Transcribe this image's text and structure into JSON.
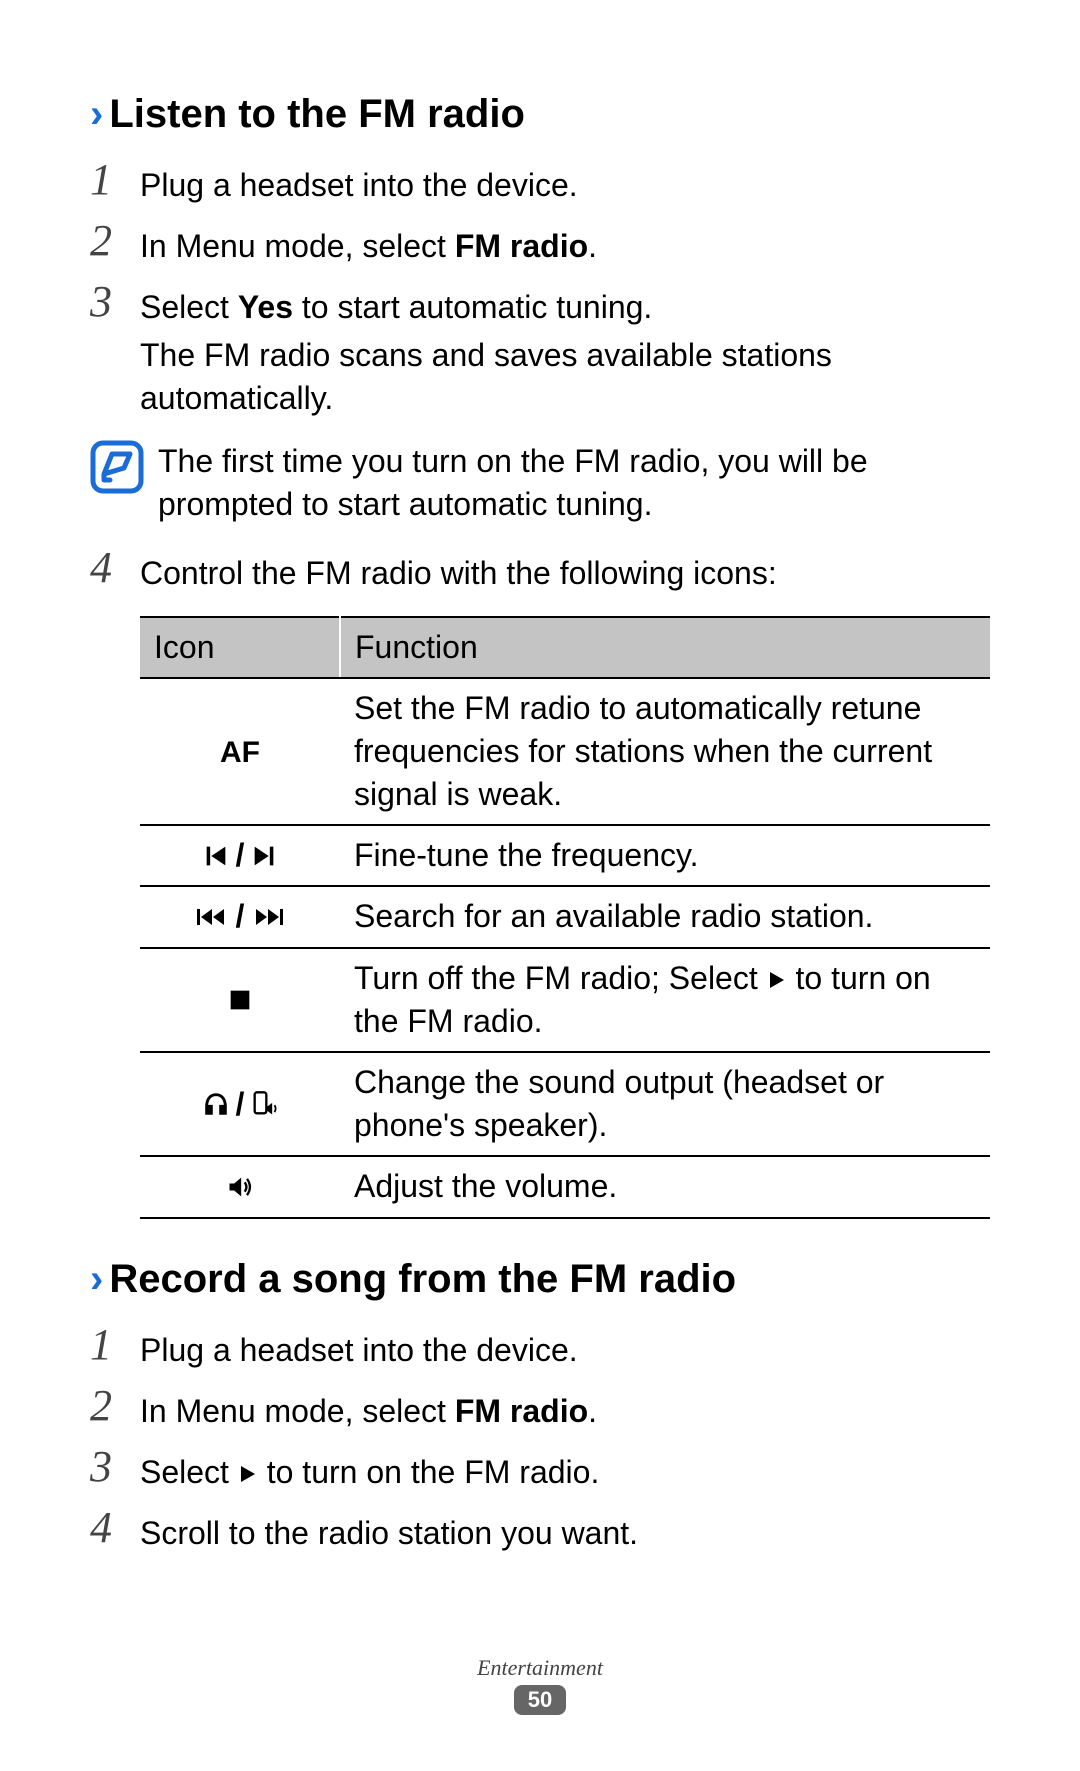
{
  "section1": {
    "title": "Listen to the FM radio",
    "steps": [
      {
        "num": "1",
        "text": "Plug a headset into the device."
      },
      {
        "num": "2",
        "prefix": "In Menu mode, select ",
        "bold": "FM radio",
        "suffix": "."
      },
      {
        "num": "3",
        "prefix": "Select ",
        "bold": "Yes",
        "suffix": " to start automatic tuning.",
        "subtext": "The FM radio scans and saves available stations automatically."
      },
      {
        "num": "4",
        "text": "Control the FM radio with the following icons:"
      }
    ],
    "note": "The first time you turn on the FM radio, you will be prompted to start automatic tuning."
  },
  "table": {
    "headers": [
      "Icon",
      "Function"
    ],
    "rows": [
      {
        "icon_label": "AF",
        "function": "Set the FM radio to automatically retune frequencies for stations when the current signal is weak."
      },
      {
        "function": "Fine-tune the frequency."
      },
      {
        "function": "Search for an available radio station."
      },
      {
        "function_prefix": "Turn off the FM radio; Select ",
        "function_suffix": " to turn on the FM radio."
      },
      {
        "function": "Change the sound output (headset or phone's speaker)."
      },
      {
        "function": "Adjust the volume."
      }
    ]
  },
  "section2": {
    "title": "Record a song from the FM radio",
    "steps": [
      {
        "num": "1",
        "text": "Plug a headset into the device."
      },
      {
        "num": "2",
        "prefix": "In Menu mode, select ",
        "bold": "FM radio",
        "suffix": "."
      },
      {
        "num": "3",
        "prefix": "Select ",
        "suffix": " to turn on the FM radio.",
        "has_play_icon": true
      },
      {
        "num": "4",
        "text": "Scroll to the radio station you want."
      }
    ]
  },
  "footer": {
    "category": "Entertainment",
    "page": "50"
  }
}
